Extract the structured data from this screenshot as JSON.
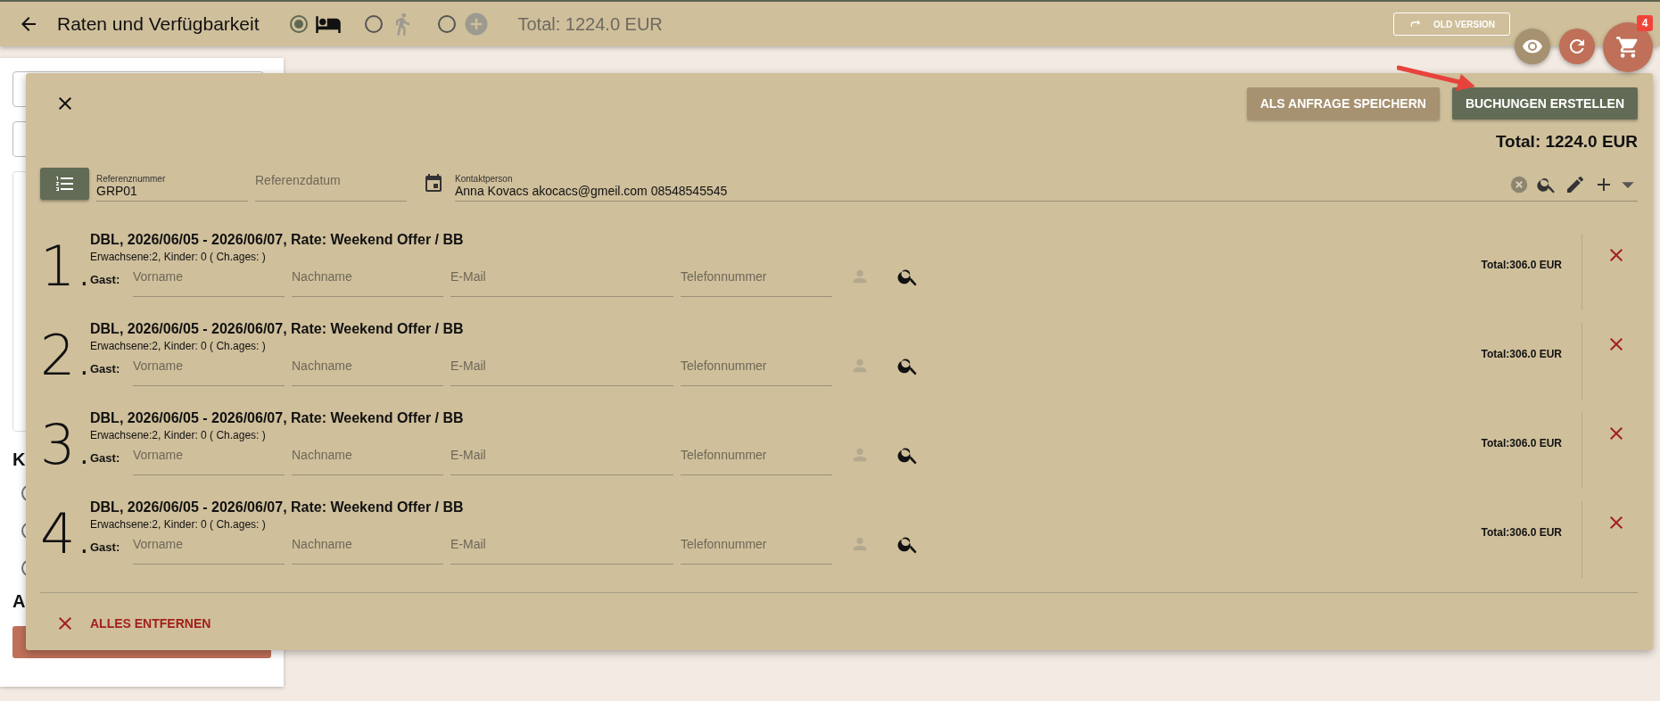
{
  "header": {
    "title": "Raten und Verfügbarkeit",
    "modes": [
      {
        "kind": "bed",
        "selected": true
      },
      {
        "kind": "walk",
        "selected": false
      },
      {
        "kind": "add",
        "selected": false
      }
    ],
    "total": "Total: 1224.0 EUR",
    "old_version": "OLD VERSION"
  },
  "floating": {
    "cart_count": "4"
  },
  "background": {
    "headings": [
      "K",
      "A"
    ],
    "options": [
      {
        "checked": false
      },
      {
        "checked": false
      },
      {
        "checked": false
      }
    ]
  },
  "dialog": {
    "actions": [
      {
        "label": "ALS ANFRAGE SPEICHERN",
        "kind": "secondary"
      },
      {
        "label": "BUCHUNGEN ERSTELLEN",
        "kind": "primary"
      }
    ],
    "total": "Total: 1224.0 EUR",
    "reference": {
      "label": "Referenznummer",
      "value": "GRP01"
    },
    "reference_date": {
      "placeholder": "Referenzdatum"
    },
    "contact": {
      "label": "Kontaktperson",
      "value": "Anna Kovacs akocacs@gmeil.com 08548545545"
    },
    "bookings": [
      {
        "number": "1.",
        "title": "DBL, 2026/06/05 - 2026/06/07, Rate: Weekend Offer / BB",
        "details": "Erwachsene:2, Kinder: 0 ( Ch.ages: )",
        "guest_label": "Gast:",
        "fields": [
          {
            "placeholder": "Vorname"
          },
          {
            "placeholder": "Nachname"
          },
          {
            "placeholder": "E-Mail"
          },
          {
            "placeholder": "Telefonnummer"
          }
        ],
        "total": "Total:306.0 EUR"
      },
      {
        "number": "2.",
        "title": "DBL, 2026/06/05 - 2026/06/07, Rate: Weekend Offer / BB",
        "details": "Erwachsene:2, Kinder: 0 ( Ch.ages: )",
        "guest_label": "Gast:",
        "fields": [
          {
            "placeholder": "Vorname"
          },
          {
            "placeholder": "Nachname"
          },
          {
            "placeholder": "E-Mail"
          },
          {
            "placeholder": "Telefonnummer"
          }
        ],
        "total": "Total:306.0 EUR"
      },
      {
        "number": "3.",
        "title": "DBL, 2026/06/05 - 2026/06/07, Rate: Weekend Offer / BB",
        "details": "Erwachsene:2, Kinder: 0 ( Ch.ages: )",
        "guest_label": "Gast:",
        "fields": [
          {
            "placeholder": "Vorname"
          },
          {
            "placeholder": "Nachname"
          },
          {
            "placeholder": "E-Mail"
          },
          {
            "placeholder": "Telefonnummer"
          }
        ],
        "total": "Total:306.0 EUR"
      },
      {
        "number": "4.",
        "title": "DBL, 2026/06/05 - 2026/06/07, Rate: Weekend Offer / BB",
        "details": "Erwachsene:2, Kinder: 0 ( Ch.ages: )",
        "guest_label": "Gast:",
        "fields": [
          {
            "placeholder": "Vorname"
          },
          {
            "placeholder": "Nachname"
          },
          {
            "placeholder": "E-Mail"
          },
          {
            "placeholder": "Telefonnummer"
          }
        ],
        "total": "Total:306.0 EUR"
      }
    ],
    "remove_all": "ALLES ENTFERNEN"
  }
}
